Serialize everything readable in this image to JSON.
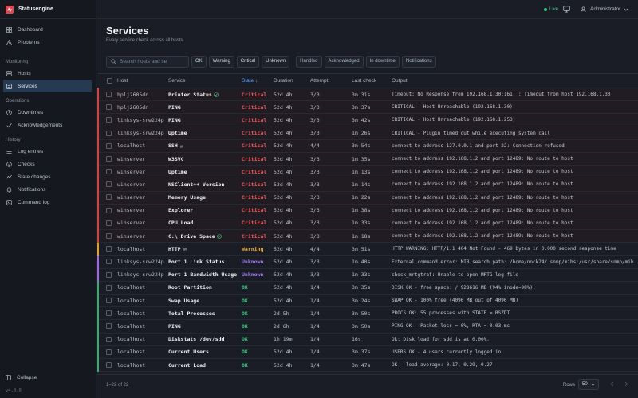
{
  "brand": {
    "name": "Statusengine",
    "color": "#e1474f"
  },
  "nav": {
    "items_top": [
      {
        "label": "Dashboard",
        "icon": "grid-icon"
      },
      {
        "label": "Problems",
        "icon": "warning-icon"
      }
    ],
    "sections": [
      {
        "title": "Monitoring",
        "items": [
          {
            "label": "Hosts",
            "icon": "server-icon"
          },
          {
            "label": "Services",
            "icon": "services-icon",
            "active": true
          }
        ]
      },
      {
        "title": "Operations",
        "items": [
          {
            "label": "Downtimes",
            "icon": "clock-icon"
          },
          {
            "label": "Acknowledgements",
            "icon": "check-icon"
          }
        ]
      },
      {
        "title": "History",
        "items": [
          {
            "label": "Log entries",
            "icon": "list-icon"
          },
          {
            "label": "Checks",
            "icon": "checks-icon"
          },
          {
            "label": "State changes",
            "icon": "state-icon"
          },
          {
            "label": "Notifications",
            "icon": "bell-icon"
          },
          {
            "label": "Command log",
            "icon": "terminal-icon"
          }
        ]
      }
    ],
    "collapse_label": "Collapse",
    "version": "v4.0.0"
  },
  "topbar": {
    "live_label": "Live",
    "user_label": "Administrator"
  },
  "header": {
    "title": "Services",
    "subtitle": "Every service check across all hosts."
  },
  "filters": {
    "search_placeholder": "Search hosts and se",
    "state_chips": [
      "OK",
      "Warning",
      "Critical",
      "Unknown"
    ],
    "flag_chips": [
      "Handled",
      "Acknowledged",
      "In downtime",
      "Notifications"
    ]
  },
  "table": {
    "columns": [
      "Host",
      "Service",
      "State ↓",
      "Duration",
      "Attempt",
      "Last check",
      "Output"
    ],
    "rows": [
      {
        "host": "hplj2605dn",
        "service": "Printer Status",
        "icon": "ack",
        "state": "Critical",
        "duration": "52d 4h",
        "attempt": "3/3",
        "last": "3m 31s",
        "output": "Timeout: No Response from 192.168.1.30:161. : Timeout from host 192.168.1.30"
      },
      {
        "host": "hplj2605dn",
        "service": "PING",
        "icon": "",
        "state": "Critical",
        "duration": "52d 4h",
        "attempt": "3/3",
        "last": "3m 37s",
        "output": "CRITICAL - Host Unreachable (192.168.1.30)"
      },
      {
        "host": "linksys-srw224p",
        "service": "PING",
        "icon": "",
        "state": "Critical",
        "duration": "52d 4h",
        "attempt": "3/3",
        "last": "3m 42s",
        "output": "CRITICAL - Host Unreachable (192.168.1.253)"
      },
      {
        "host": "linksys-srw224p",
        "service": "Uptime",
        "icon": "",
        "state": "Critical",
        "duration": "52d 4h",
        "attempt": "3/3",
        "last": "1m 26s",
        "output": "CRITICAL - Plugin timed out while executing system call"
      },
      {
        "host": "localhost",
        "service": "SSH",
        "icon": "flap",
        "state": "Critical",
        "duration": "52d 4h",
        "attempt": "4/4",
        "last": "3m 54s",
        "output": "connect to address 127.0.0.1 and port 22: Connection refused"
      },
      {
        "host": "winserver",
        "service": "W3SVC",
        "icon": "",
        "state": "Critical",
        "duration": "52d 4h",
        "attempt": "3/3",
        "last": "1m 35s",
        "output": "connect to address 192.168.1.2 and port 12489: No route to host"
      },
      {
        "host": "winserver",
        "service": "Uptime",
        "icon": "",
        "state": "Critical",
        "duration": "52d 4h",
        "attempt": "3/3",
        "last": "1m 13s",
        "output": "connect to address 192.168.1.2 and port 12489: No route to host"
      },
      {
        "host": "winserver",
        "service": "NSClient++ Version",
        "icon": "",
        "state": "Critical",
        "duration": "52d 4h",
        "attempt": "3/3",
        "last": "1m 14s",
        "output": "connect to address 192.168.1.2 and port 12489: No route to host"
      },
      {
        "host": "winserver",
        "service": "Memory Usage",
        "icon": "",
        "state": "Critical",
        "duration": "52d 4h",
        "attempt": "3/3",
        "last": "1m 22s",
        "output": "connect to address 192.168.1.2 and port 12489: No route to host"
      },
      {
        "host": "winserver",
        "service": "Explorer",
        "icon": "",
        "state": "Critical",
        "duration": "52d 4h",
        "attempt": "3/3",
        "last": "1m 38s",
        "output": "connect to address 192.168.1.2 and port 12489: No route to host"
      },
      {
        "host": "winserver",
        "service": "CPU Load",
        "icon": "",
        "state": "Critical",
        "duration": "52d 4h",
        "attempt": "3/3",
        "last": "1m 33s",
        "output": "connect to address 192.168.1.2 and port 12489: No route to host"
      },
      {
        "host": "winserver",
        "service": "C:\\ Drive Space",
        "icon": "ack",
        "state": "Critical",
        "duration": "52d 4h",
        "attempt": "3/3",
        "last": "1m 18s",
        "output": "connect to address 192.168.1.2 and port 12489: No route to host"
      },
      {
        "host": "localhost",
        "service": "HTTP",
        "icon": "flap",
        "state": "Warning",
        "duration": "52d 4h",
        "attempt": "4/4",
        "last": "3m 51s",
        "output": "HTTP WARNING: HTTP/1.1 404 Not Found - 469 bytes in 0.000 second response time"
      },
      {
        "host": "linksys-srw224p",
        "service": "Port 1 Link Status",
        "icon": "",
        "state": "Unknown",
        "duration": "52d 4h",
        "attempt": "3/3",
        "last": "1m 40s",
        "output": "External command error: MIB search path: /home/nock24/.snmp/mibs:/usr/share/snmp/mibs:/..."
      },
      {
        "host": "linksys-srw224p",
        "service": "Port 1 Bandwidth Usage",
        "icon": "",
        "state": "Unknown",
        "duration": "52d 4h",
        "attempt": "3/3",
        "last": "1m 33s",
        "output": "check_mrtgtraf: Unable to open MRTG log file"
      },
      {
        "host": "localhost",
        "service": "Root Partition",
        "icon": "",
        "state": "OK",
        "duration": "52d 4h",
        "attempt": "1/4",
        "last": "3m 35s",
        "output": "DISK OK - free space: / 928616 MB (94% inode=98%):"
      },
      {
        "host": "localhost",
        "service": "Swap Usage",
        "icon": "",
        "state": "OK",
        "duration": "52d 4h",
        "attempt": "1/4",
        "last": "3m 24s",
        "output": "SWAP OK - 100% free (4096 MB out of 4096 MB)"
      },
      {
        "host": "localhost",
        "service": "Total Processes",
        "icon": "",
        "state": "OK",
        "duration": "2d 5h",
        "attempt": "1/4",
        "last": "3m 50s",
        "output": "PROCS OK: 55 processes with STATE = RSZDT"
      },
      {
        "host": "localhost",
        "service": "PING",
        "icon": "",
        "state": "OK",
        "duration": "2d 6h",
        "attempt": "1/4",
        "last": "3m 50s",
        "output": "PING OK - Packet loss = 0%, RTA = 0.03 ms"
      },
      {
        "host": "localhost",
        "service": "Diskstats /dev/sdd",
        "icon": "",
        "state": "OK",
        "duration": "1h 19m",
        "attempt": "1/4",
        "last": "16s",
        "output": "Ok: Disk load for sdd is at 0.00%."
      },
      {
        "host": "localhost",
        "service": "Current Users",
        "icon": "",
        "state": "OK",
        "duration": "52d 4h",
        "attempt": "1/4",
        "last": "3m 37s",
        "output": "USERS OK - 4 users currently logged in"
      },
      {
        "host": "localhost",
        "service": "Current Load",
        "icon": "",
        "state": "OK",
        "duration": "52d 4h",
        "attempt": "1/4",
        "last": "3m 47s",
        "output": "OK - load average: 0.17, 0.29, 0.27"
      }
    ]
  },
  "footer": {
    "range_label": "1–22 of 22",
    "rows_label": "Rows",
    "rows_value": "50"
  }
}
